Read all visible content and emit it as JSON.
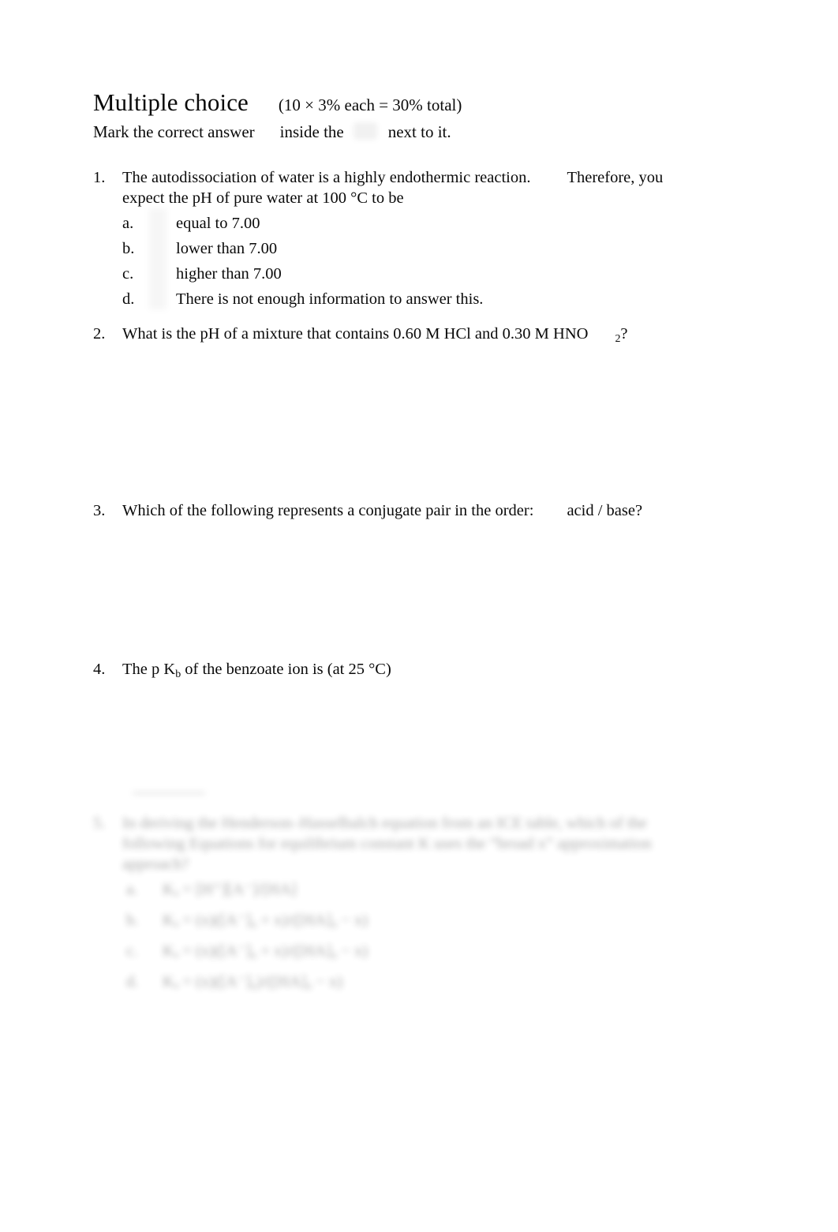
{
  "document": {
    "heading": {
      "title": "Multiple choice",
      "points": "(10 × 3% each = 30% total)",
      "instruction_prefix": "Mark the correct answer",
      "instruction_middle": "inside the",
      "instruction_suffix": "next to it.",
      "checkbox_icon": "checkbox-icon"
    },
    "questions": [
      {
        "number": "1.",
        "line1": "The autodissociation of water is a highly endothermic reaction.",
        "line1_tail": "Therefore, you",
        "line2": "expect the pH of pure water at 100 °C to be",
        "options": [
          {
            "letter": "a.",
            "text": "equal to 7.00"
          },
          {
            "letter": "b.",
            "text": "lower than 7.00"
          },
          {
            "letter": "c.",
            "text": "higher than 7.00"
          },
          {
            "letter": "d.",
            "text": "There is not enough information to answer this."
          }
        ]
      },
      {
        "number": "2.",
        "text_before": "What is the pH of a mixture that contains 0.60 M HCl and 0.30 M HNO",
        "subscript": "2",
        "text_after": "?"
      },
      {
        "number": "3.",
        "text_before": "Which of the following represents a conjugate pair in the order:",
        "text_after": "acid / base?"
      },
      {
        "number": "4.",
        "text_before": "The p K",
        "subscript": "b",
        "text_after": " of the benzoate ion is (at 25 °C)"
      },
      {
        "number": "5.",
        "blurred": true,
        "line1": "In deriving the Henderson–Hasselbalch equation from an ICE table, which of the",
        "line2": "following Equations for equilibrium constant K uses the “broad x” approximation",
        "line3": "approach?",
        "options": [
          {
            "letter": "a.",
            "text": "Kₐ = [H⁺][A⁻]/[HA]"
          },
          {
            "letter": "b.",
            "text": "Kₐ = (x)([A⁻]₀ + x)/([HA]₀ − x)"
          },
          {
            "letter": "c.",
            "text": "Kₐ = (x)([A⁻]₀ + x)/([HA]₀ − x)"
          },
          {
            "letter": "d.",
            "text": "Kₐ = (x)([A⁻]₀)/([HA]₀ − x)"
          }
        ]
      }
    ]
  }
}
